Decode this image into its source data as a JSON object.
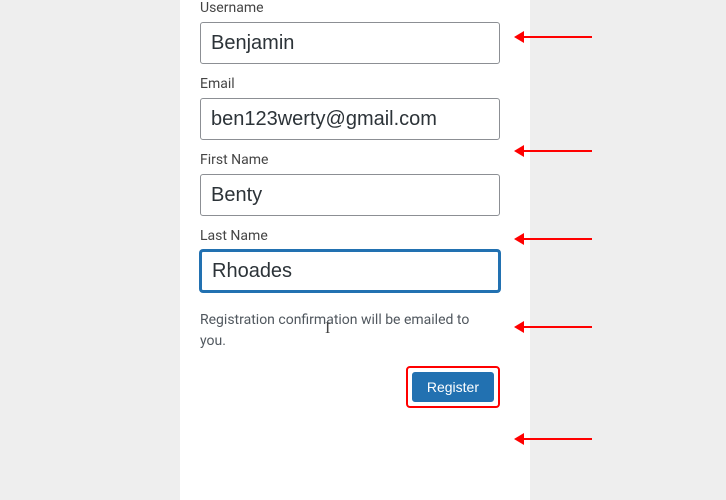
{
  "form": {
    "username": {
      "label": "Username",
      "value": "Benjamin"
    },
    "email": {
      "label": "Email",
      "value": "ben123werty@gmail.com"
    },
    "first_name": {
      "label": "First Name",
      "value": "Benty"
    },
    "last_name": {
      "label": "Last Name",
      "value": "Rhoades"
    },
    "confirmation_text": "Registration confirmation will be emailed to you.",
    "register_label": "Register"
  }
}
